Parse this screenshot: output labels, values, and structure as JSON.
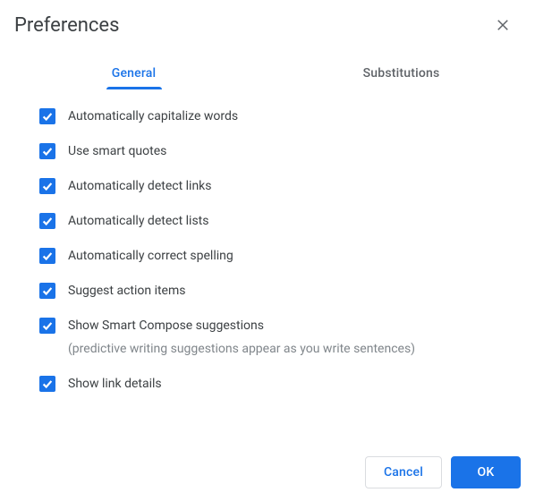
{
  "dialog": {
    "title": "Preferences"
  },
  "tabs": {
    "general": "General",
    "substitutions": "Substitutions",
    "active": "general"
  },
  "options": [
    {
      "label": "Automatically capitalize words",
      "checked": true
    },
    {
      "label": "Use smart quotes",
      "checked": true
    },
    {
      "label": "Automatically detect links",
      "checked": true
    },
    {
      "label": "Automatically detect lists",
      "checked": true
    },
    {
      "label": "Automatically correct spelling",
      "checked": true
    },
    {
      "label": "Suggest action items",
      "checked": true
    },
    {
      "label": "Show Smart Compose suggestions",
      "checked": true,
      "sub": "(predictive writing suggestions appear as you write sentences)"
    },
    {
      "label": "Show link details",
      "checked": true
    }
  ],
  "footer": {
    "cancel": "Cancel",
    "ok": "OK"
  }
}
